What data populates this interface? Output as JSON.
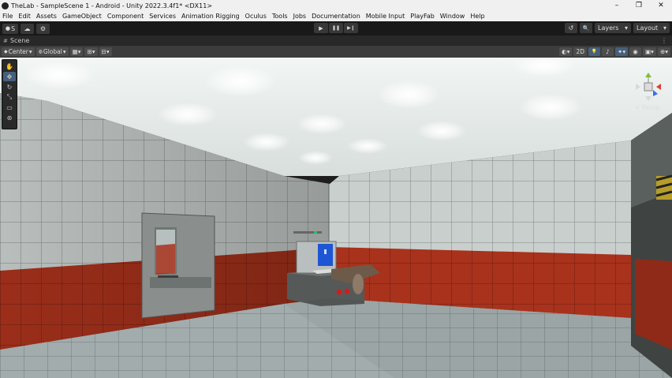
{
  "window": {
    "title": "TheLab - SampleScene 1 - Android - Unity 2022.3.4f1* <DX11>",
    "minimize": "–",
    "maximize": "❐",
    "close": "✕"
  },
  "menu": [
    "File",
    "Edit",
    "Assets",
    "GameObject",
    "Component",
    "Services",
    "Animation Rigging",
    "Oculus",
    "Tools",
    "Jobs",
    "Documentation",
    "Mobile Input",
    "PlayFab",
    "Window",
    "Help"
  ],
  "toolbar": {
    "account_label": "S",
    "account_caret": "▾",
    "cloud_icon": "☁",
    "settings_icon": "⚙",
    "play_icon": "▶",
    "pause_icon": "❚❚",
    "step_icon": "▶❙",
    "history_icon": "↺",
    "search_icon": "🔍",
    "layers_label": "Layers",
    "layout_label": "Layout",
    "caret": "▾"
  },
  "scene_tab": {
    "icon": "#",
    "label": "Scene",
    "menu_icon": "⋮"
  },
  "scene_toolbar": {
    "pivot_label": "Center",
    "space_label": "Global",
    "caret": "▾",
    "grid_icon": "▦",
    "snap_icon": "⊞",
    "increment_icon": "⊟",
    "shading_icon": "◐",
    "mode_2d_label": "2D",
    "light_icon": "💡",
    "audio_icon": "♪",
    "fx_icon": "✦",
    "hidden_icon": "◉",
    "camera_icon": "▣",
    "gizmos_icon": "⊕"
  },
  "tools": [
    {
      "name": "hand-tool-icon",
      "glyph": "✋"
    },
    {
      "name": "move-tool-icon",
      "glyph": "✥"
    },
    {
      "name": "rotate-tool-icon",
      "glyph": "↻"
    },
    {
      "name": "scale-tool-icon",
      "glyph": "⤡"
    },
    {
      "name": "rect-tool-icon",
      "glyph": "▭"
    },
    {
      "name": "transform-tool-icon",
      "glyph": "⊛"
    }
  ],
  "gizmo": {
    "projection_label": "< Persp"
  },
  "colors": {
    "tile_wall": "#c9cfcd",
    "red_band": "#a8321c",
    "ceiling": "#e9eeec",
    "floor": "#aeb7b7",
    "accent": "#46607c"
  }
}
